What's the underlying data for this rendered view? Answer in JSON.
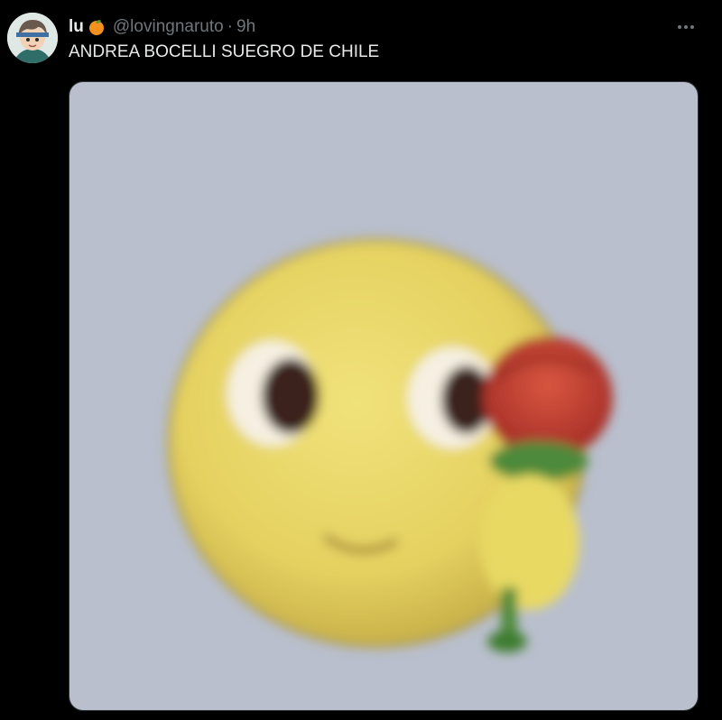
{
  "tweet": {
    "display_name": "lu",
    "name_emoji": "orange-emoji",
    "handle": "@lovingnaruto",
    "separator": "·",
    "time": "9h",
    "text": "ANDREA BOCELLI SUEGRO DE CHILE",
    "more_icon": "more-horizontal-icon"
  },
  "media": {
    "kind": "image",
    "subject": "emoji-face-with-rose",
    "colors": {
      "background": "#b9bfcd",
      "face": "#e9d86a",
      "rose": "#c83a2c",
      "stem": "#4e8a3a"
    }
  },
  "colors": {
    "page_background": "#000000",
    "primary_text": "#e7e9ea",
    "secondary_text": "#71767b"
  }
}
